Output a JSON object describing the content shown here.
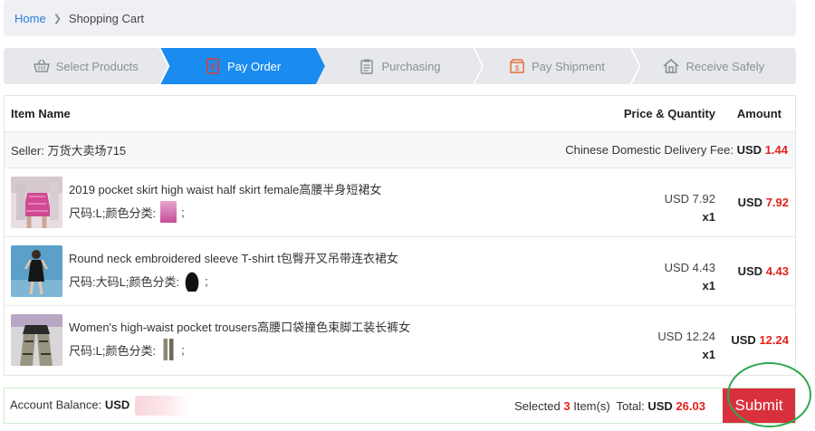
{
  "breadcrumb": {
    "home": "Home",
    "current": "Shopping Cart"
  },
  "steps": [
    {
      "label": "Select Products",
      "icon": "basket-icon"
    },
    {
      "label": "Pay Order",
      "icon": "payment-icon"
    },
    {
      "label": "Purchasing",
      "icon": "clipboard-icon"
    },
    {
      "label": "Pay Shipment",
      "icon": "package-icon"
    },
    {
      "label": "Receive Safely",
      "icon": "home-icon"
    }
  ],
  "active_step": "Pay Order",
  "table": {
    "headers": {
      "item_name": "Item Name",
      "price_qty": "Price & Quantity",
      "amount": "Amount"
    },
    "seller": {
      "label": "Seller: 万货大卖场715",
      "fee_label": "Chinese Domestic Delivery Fee:",
      "fee_currency": "USD",
      "fee_value": "1.44"
    },
    "items": [
      {
        "title": "2019 pocket skirt high waist half skirt female高腰半身短裙女",
        "spec_prefix": "尺码:L;颜色分类:",
        "spec_suffix": ";",
        "unit_price": "USD 7.92",
        "qty": "x1",
        "amount_currency": "USD",
        "amount_value": "7.92"
      },
      {
        "title": "Round neck embroidered sleeve T-shirt t包臀开叉吊带连衣裙女",
        "spec_prefix": "尺码:大码L;颜色分类:",
        "spec_suffix": ";",
        "unit_price": "USD 4.43",
        "qty": "x1",
        "amount_currency": "USD",
        "amount_value": "4.43"
      },
      {
        "title": "Women's high-waist pocket trousers高腰口袋撞色束脚工装长裤女",
        "spec_prefix": "尺码:L;颜色分类:",
        "spec_suffix": ";",
        "unit_price": "USD 12.24",
        "qty": "x1",
        "amount_currency": "USD",
        "amount_value": "12.24"
      }
    ]
  },
  "footer": {
    "balance_label": "Account Balance:",
    "balance_currency": "USD",
    "selected_prefix": "Selected",
    "selected_count": "3",
    "selected_suffix": "Item(s)",
    "total_label": "Total:",
    "total_currency": "USD",
    "total_value": "26.03",
    "submit_label": "Submit"
  },
  "colors": {
    "accent": "#1a8cf0",
    "price_red": "#e2231a",
    "submit_bg": "#d9303d",
    "annotation_ring": "#2fa84f"
  }
}
